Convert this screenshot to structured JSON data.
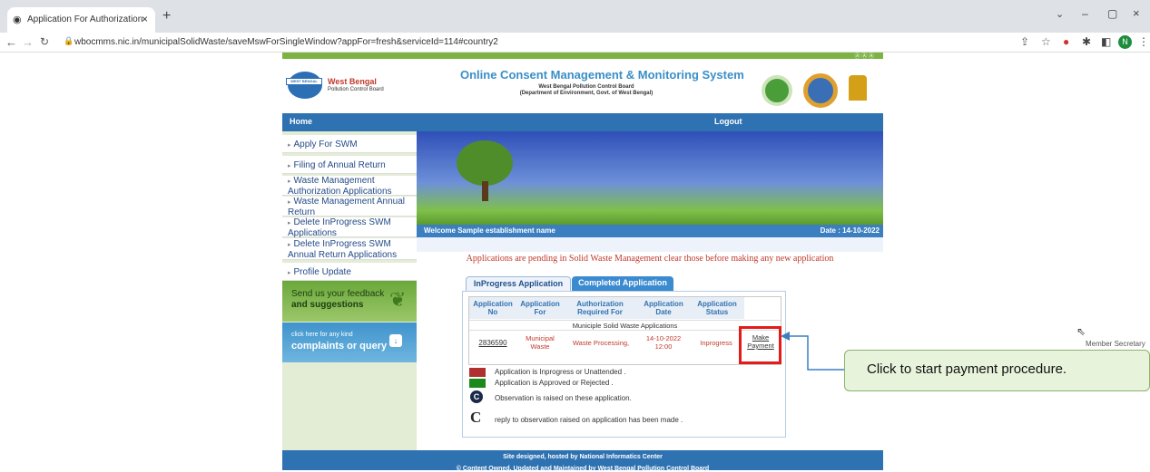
{
  "browser": {
    "tab_title": "Application For Authorization",
    "url": "wbocmms.nic.in/municipalSolidWaste/saveMswForSingleWindow?appFor=fresh&serviceId=114#country2",
    "avatar_letter": "N"
  },
  "header": {
    "logo_box": "WEST BENGAL",
    "logo_org1": "West Bengal",
    "logo_org2": "Pollution Control Board",
    "title": "Online Consent Management & Monitoring System",
    "subtitle1": "West Bengal Pollution Control Board",
    "subtitle2": "(Department of Environment, Govt. of West Bengal)"
  },
  "nav": {
    "home": "Home",
    "logout": "Logout"
  },
  "sidebar": {
    "items": [
      {
        "label": "Apply For SWM"
      },
      {
        "label": "Filing of Annual Return"
      },
      {
        "label": "Waste Management Authorization Applications"
      },
      {
        "label": "Waste Management Annual Return"
      },
      {
        "label": "Delete InProgress SWM Applications"
      },
      {
        "label": "Delete InProgress SWM Annual Return Applications"
      },
      {
        "label": "Profile Update"
      }
    ],
    "feedback1": "Send us your feedback",
    "feedback2": "and suggestions",
    "complaint1": "click here for any kind",
    "complaint2": "complaints or query"
  },
  "welcome": {
    "text": "Welcome Sample establishment name",
    "date": "Date : 14-10-2022"
  },
  "notice": "Applications are pending in Solid Waste Management clear those before making any new application",
  "tabs": {
    "inprogress": "InProgress Application",
    "completed": "Completed Application"
  },
  "table": {
    "headers": [
      "Application No",
      "Application For",
      "Authorization Required For",
      "Application Date",
      "Application Status"
    ],
    "group": "Municiple Solid Waste Applications",
    "row": {
      "no": "2836590",
      "for": "Municipal Waste",
      "required": "Waste Processing,",
      "date": "14-10-2022 12:00",
      "status": "Inprogress",
      "action": "Make Payment"
    }
  },
  "legend": [
    {
      "text": "Application is Inprogress or Unattended .",
      "color": "#b03030"
    },
    {
      "text": "Application is Approved or Rejected .",
      "color": "#1a8a1a"
    },
    {
      "text": "Observation is raised on these application.",
      "icon": "C"
    },
    {
      "text": "reply to observation raised on application has been made .",
      "icon": "C"
    }
  ],
  "callout": "Click to start payment procedure.",
  "member": "Member Secretary",
  "footer": {
    "line1": "Site designed, hosted by National Informatics Center",
    "line2": "© Content Owned, Updated and Maintained by West Bengal Pollution Control Board"
  }
}
